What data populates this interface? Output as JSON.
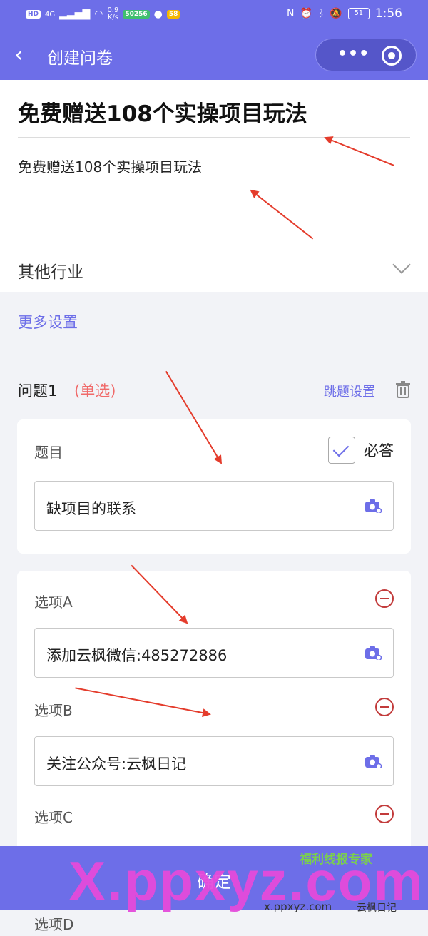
{
  "status_bar": {
    "left_badges": [
      "HD",
      "4G"
    ],
    "net_speed": "0.9\nK/s",
    "app_chips": [
      "50256",
      "58"
    ],
    "battery": "51",
    "time": "1:56"
  },
  "nav": {
    "back_icon": "chevron-left-icon",
    "title": "创建问卷",
    "more_icon": "more-dots-icon",
    "close_icon": "target-close-icon"
  },
  "survey": {
    "title": "免费赠送108个实操项目玩法",
    "description": "免费赠送108个实操项目玩法",
    "industry": "其他行业"
  },
  "more_settings": "更多设置",
  "question": {
    "number_label": "问题1",
    "type_label": "(单选)",
    "jump_settings": "跳题设置",
    "topic_label": "题目",
    "required_label": "必答",
    "required_checked": true,
    "topic_value": "缺项目的联系"
  },
  "options": [
    {
      "label": "选项A",
      "value": "添加云枫微信:485272886"
    },
    {
      "label": "选项B",
      "value": "关注公众号:云枫日记"
    },
    {
      "label": "选项C",
      "value": ""
    },
    {
      "label": "选项D",
      "value": ""
    }
  ],
  "bottom": {
    "confirm_label": "确定"
  },
  "watermark": {
    "big": "X.ppxyz.com",
    "tag": "福利线报专家",
    "small": "x.ppxyz.com",
    "account": "云枫日记"
  },
  "colors": {
    "accent": "#6d6ee8",
    "danger": "#c23b3b",
    "type_red": "#f06a6a",
    "arrow_red": "#e43c2c"
  }
}
